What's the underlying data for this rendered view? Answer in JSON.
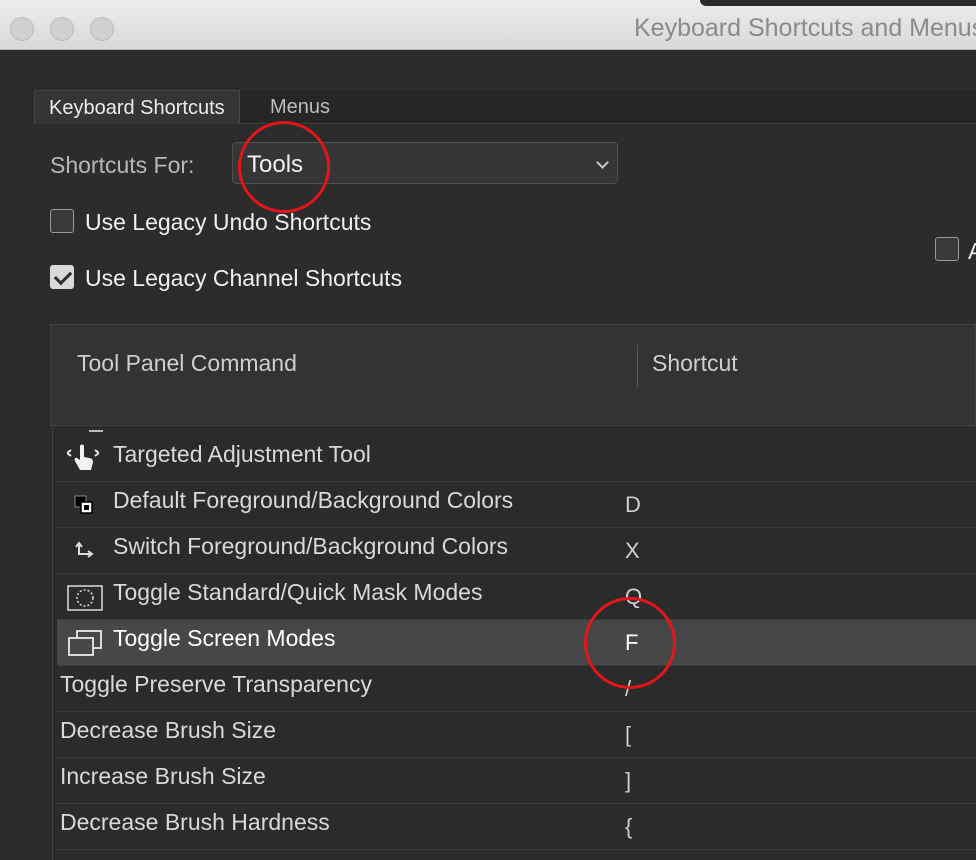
{
  "window": {
    "title": "Keyboard Shortcuts and Menus"
  },
  "tabs": [
    {
      "label": "Keyboard Shortcuts"
    },
    {
      "label": "Menus"
    }
  ],
  "shortcuts_for": {
    "label": "Shortcuts For:",
    "value": "Tools"
  },
  "options": {
    "legacy_undo": {
      "label": "Use Legacy Undo Shortcuts",
      "checked": false
    },
    "legacy_channel": {
      "label": "Use Legacy Channel Shortcuts",
      "checked": true
    },
    "truncated_checkbox_letter": "A"
  },
  "table": {
    "headers": {
      "command": "Tool Panel Command",
      "shortcut": "Shortcut"
    },
    "rows": [
      {
        "icon": "targeted-adjustment-icon",
        "name": "Targeted Adjustment Tool",
        "shortcut": ""
      },
      {
        "icon": "default-colors-icon",
        "name": "Default Foreground/Background Colors",
        "shortcut": "D"
      },
      {
        "icon": "switch-colors-icon",
        "name": "Switch Foreground/Background Colors",
        "shortcut": "X"
      },
      {
        "icon": "quick-mask-icon",
        "name": "Toggle Standard/Quick Mask Modes",
        "shortcut": "Q"
      },
      {
        "icon": "screen-modes-icon",
        "name": "Toggle Screen Modes",
        "shortcut": "F",
        "selected": true
      },
      {
        "icon": "",
        "name": "Toggle Preserve Transparency",
        "shortcut": "/"
      },
      {
        "icon": "",
        "name": "Decrease Brush Size",
        "shortcut": "["
      },
      {
        "icon": "",
        "name": "Increase Brush Size",
        "shortcut": "]"
      },
      {
        "icon": "",
        "name": "Decrease Brush Hardness",
        "shortcut": "{"
      }
    ]
  },
  "colors": {
    "annotation_red": "#e4151b",
    "dialog_bg": "#2c2c2c",
    "selected_row": "#474747"
  }
}
